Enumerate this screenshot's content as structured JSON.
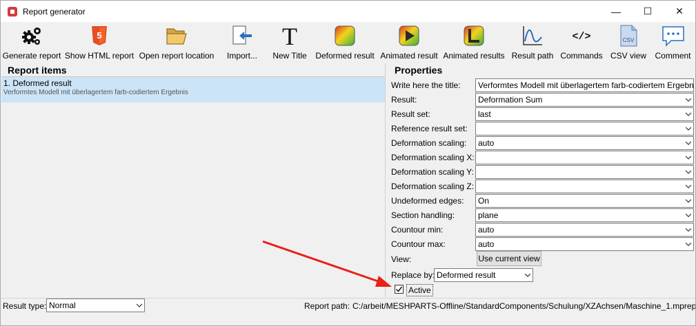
{
  "window": {
    "title": "Report generator",
    "controls": [
      "—",
      "☐",
      "✕"
    ]
  },
  "toolbar": [
    {
      "label": "Generate report",
      "icon": "gears-icon"
    },
    {
      "label": "Show HTML report",
      "icon": "html5-icon"
    },
    {
      "label": "Open report location",
      "icon": "folder-open-icon"
    },
    {
      "label": "Import...",
      "icon": "import-icon"
    },
    {
      "label": "New Title",
      "icon": "title-T-icon"
    },
    {
      "label": "Deformed result",
      "icon": "deformed-result-icon"
    },
    {
      "label": "Animated result",
      "icon": "animated-result-icon"
    },
    {
      "label": "Animated results",
      "icon": "animated-results-icon"
    },
    {
      "label": "Result path",
      "icon": "result-path-icon"
    },
    {
      "label": "Commands",
      "icon": "code-brackets-icon"
    },
    {
      "label": "CSV view",
      "icon": "csv-file-icon"
    },
    {
      "label": "Comment",
      "icon": "comment-icon"
    }
  ],
  "report_items": {
    "heading": "Report items",
    "items": [
      {
        "title": "1. Deformed result",
        "subtitle": "Verformtes Modell mit überlagertem farb-codiertem Ergebnis"
      }
    ]
  },
  "properties": {
    "heading": "Properties",
    "rows": [
      {
        "label": "Write here the title:",
        "value": "Verformtes Modell mit überlagertem farb-codiertem Ergebnis",
        "dropdown": false
      },
      {
        "label": "Result:",
        "value": "Deformation Sum",
        "dropdown": true
      },
      {
        "label": "Result set:",
        "value": "last",
        "dropdown": true
      },
      {
        "label": "Reference result set:",
        "value": "",
        "dropdown": true
      },
      {
        "label": "Deformation scaling:",
        "value": "auto",
        "dropdown": true
      },
      {
        "label": "Deformation scaling X:",
        "value": "",
        "dropdown": true
      },
      {
        "label": "Deformation scaling Y:",
        "value": "",
        "dropdown": true
      },
      {
        "label": "Deformation scaling Z:",
        "value": "",
        "dropdown": true
      },
      {
        "label": "Undeformed edges:",
        "value": "On",
        "dropdown": true
      },
      {
        "label": "Section handling:",
        "value": "plane",
        "dropdown": true
      },
      {
        "label": "Countour min:",
        "value": "auto",
        "dropdown": true
      },
      {
        "label": "Countour max:",
        "value": "auto",
        "dropdown": true
      }
    ],
    "view_label": "View:",
    "view_button": "Use current view",
    "replace_label": "Replace by:",
    "replace_value": "Deformed result",
    "active_label": "Active",
    "active_checked": true
  },
  "status": {
    "result_type_label": "Result type:",
    "result_type_value": "Normal",
    "report_path_label": "Report path:",
    "report_path_value": "C:/arbeit/MESHPARTS-Offline/StandardComponents/Schulung/XZAchsen/Maschine_1.mprep"
  },
  "colors": {
    "selection": "#cce4f7",
    "annotation_arrow": "#e8211a"
  }
}
